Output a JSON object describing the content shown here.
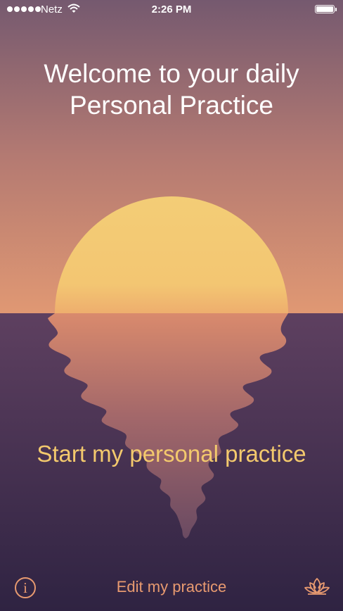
{
  "status_bar": {
    "carrier": "Netz",
    "time": "2:26 PM"
  },
  "welcome": {
    "line1": "Welcome to your daily",
    "line2": "Personal Practice"
  },
  "start_button": {
    "label": "Start my personal practice"
  },
  "bottom_bar": {
    "info_icon_glyph": "i",
    "edit_label": "Edit my practice",
    "right_icon": "lotus-icon"
  },
  "colors": {
    "sky_top": "#75596f",
    "sky_horizon": "#e09873",
    "sun": "#f3cd76",
    "sea_top": "#5e4060",
    "sea_bottom": "#2f2342",
    "accent_text": "#f3c96d",
    "bottom_icon": "#e89a70"
  }
}
